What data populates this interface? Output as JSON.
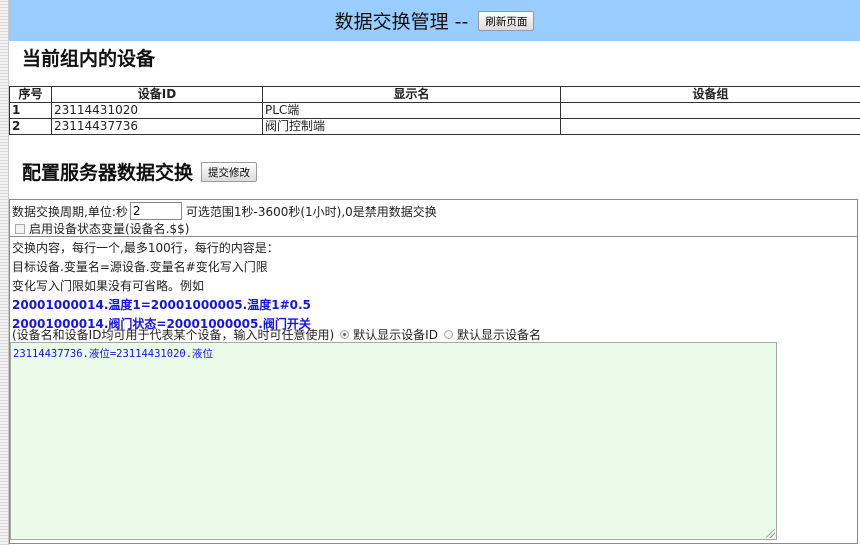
{
  "header": {
    "title": "数据交换管理 --",
    "refresh_label": "刷新页面"
  },
  "devices_section": {
    "title": "当前组内的设备",
    "columns": [
      "序号",
      "设备ID",
      "显示名",
      "设备组"
    ],
    "rows": [
      {
        "index": "1",
        "device_id": "23114431020",
        "display_name": "PLC端",
        "group": ""
      },
      {
        "index": "2",
        "device_id": "23114437736",
        "display_name": "阀门控制端",
        "group": ""
      }
    ]
  },
  "exchange_section": {
    "title": "配置服务器数据交换",
    "submit_label": "提交修改",
    "period_label": "数据交换周期,单位:秒",
    "period_value": "2",
    "period_hint": "可选范围1秒-3600秒(1小时),0是禁用数据交换",
    "enable_status_label": "启用设备状态变量(设备名.$$)",
    "instructions": [
      "交换内容，每行一个,最多100行，每行的内容是：",
      "目标设备.变量名=源设备.变量名#变化写入门限",
      "变化写入门限如果没有可省略。例如"
    ],
    "examples": [
      "20001000014.温度1=20001000005.温度1#0.5",
      "20001000014.阀门状态=20001000005.阀门开关"
    ],
    "display_note": "(设备名和设备ID均可用于代表某个设备，输入时可任意使用)",
    "radio_id_label": "默认显示设备ID",
    "radio_name_label": "默认显示设备名",
    "content_text": "23114437736.液位=23114431020.液位"
  }
}
